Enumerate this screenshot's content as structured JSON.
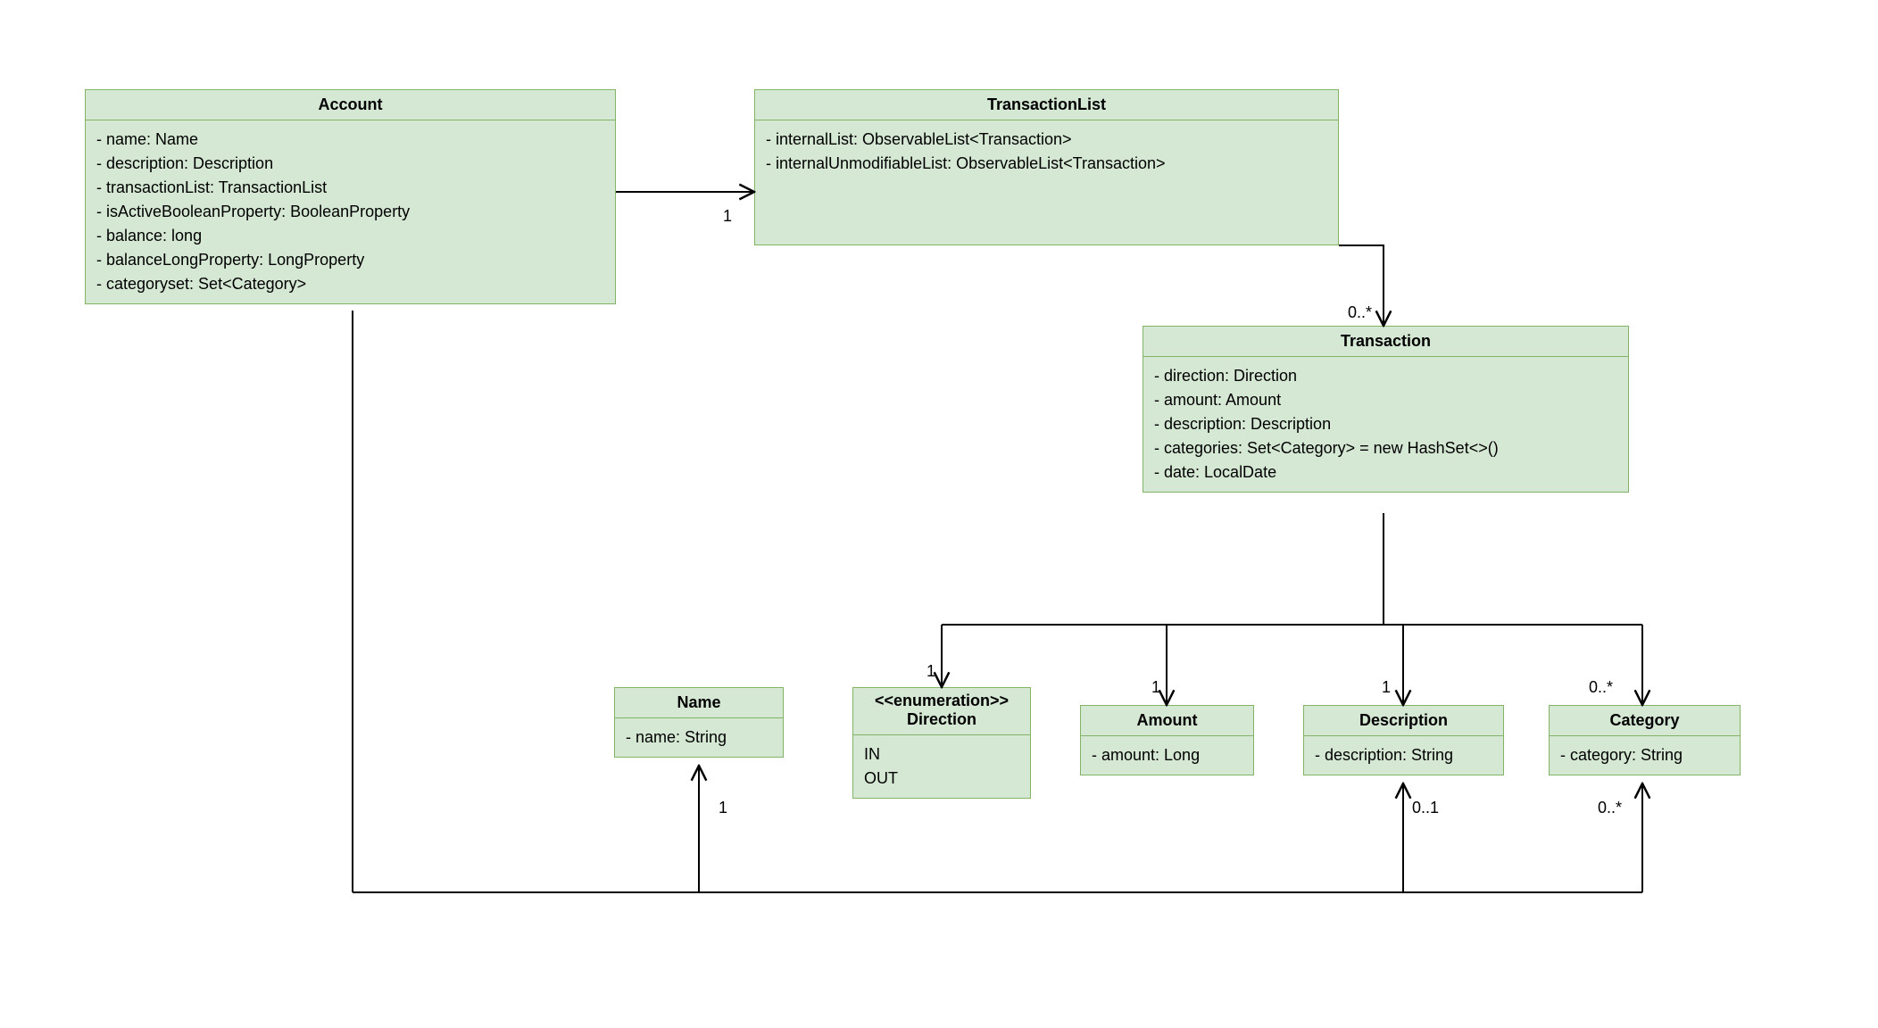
{
  "classes": {
    "account": {
      "title": "Account",
      "attrs": [
        "- name: Name",
        "- description: Description",
        "- transactionList: TransactionList",
        "- isActiveBooleanProperty: BooleanProperty",
        "- balance: long",
        "- balanceLongProperty: LongProperty",
        "- categoryset: Set<Category>"
      ]
    },
    "transactionList": {
      "title": "TransactionList",
      "attrs": [
        "- internalList: ObservableList<Transaction>",
        "- internalUnmodifiableList: ObservableList<Transaction>"
      ]
    },
    "transaction": {
      "title": "Transaction",
      "attrs": [
        "- direction: Direction",
        "- amount: Amount",
        "- description: Description",
        "- categories: Set<Category> = new HashSet<>()",
        "- date: LocalDate"
      ]
    },
    "name": {
      "title": "Name",
      "attrs": [
        "- name: String"
      ]
    },
    "direction": {
      "stereotype": "<<enumeration>>",
      "title": "Direction",
      "literals": [
        "IN",
        "OUT"
      ]
    },
    "amount": {
      "title": "Amount",
      "attrs": [
        "- amount: Long"
      ]
    },
    "description": {
      "title": "Description",
      "attrs": [
        "- description: String"
      ]
    },
    "category": {
      "title": "Category",
      "attrs": [
        "- category: String"
      ]
    }
  },
  "multiplicities": {
    "account_to_tlist": "1",
    "tlist_to_txn": "0..*",
    "txn_to_direction": "1",
    "txn_to_amount": "1",
    "txn_to_description": "1",
    "txn_to_category": "0..*",
    "account_to_name": "1",
    "account_to_description": "0..1",
    "account_to_category": "0..*"
  }
}
